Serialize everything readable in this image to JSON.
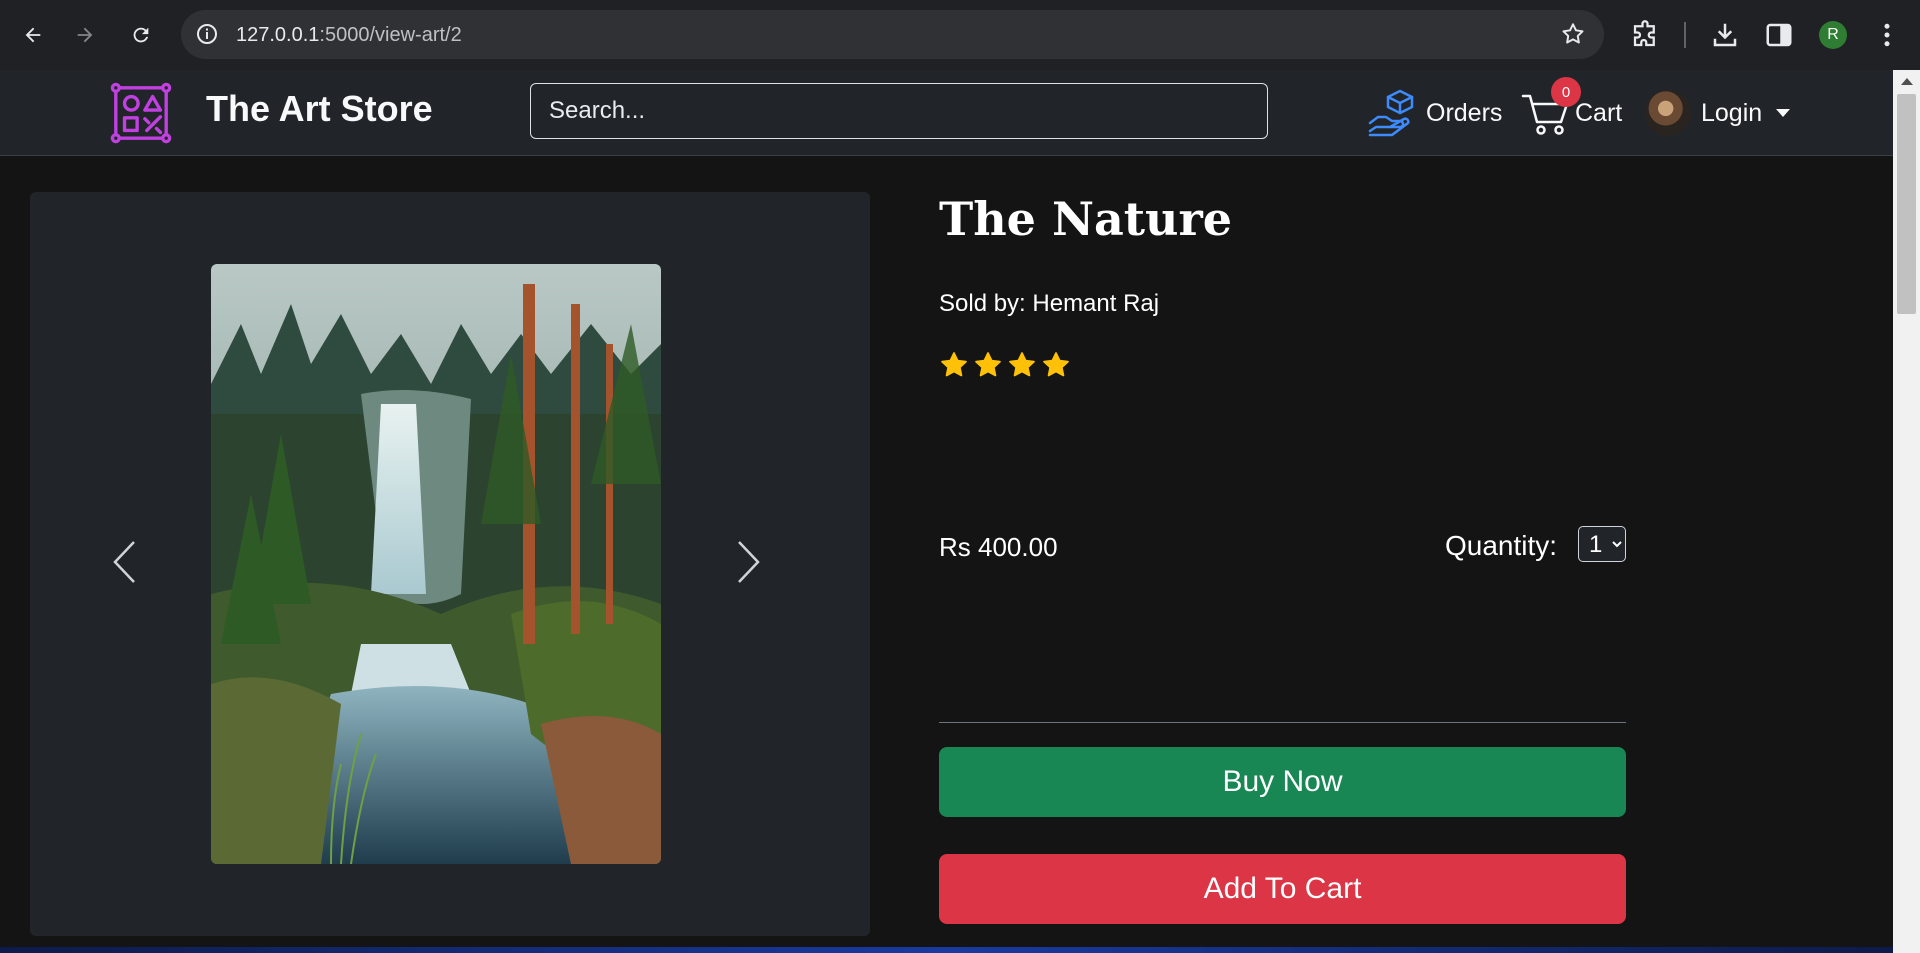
{
  "browser": {
    "url_host": "127.0.0.1",
    "url_path": ":5000/view-art/2",
    "profile_initial": "R"
  },
  "nav": {
    "brand": "The Art Store",
    "search_placeholder": "Search...",
    "orders_label": "Orders",
    "cart_label": "Cart",
    "cart_count": "0",
    "login_label": "Login"
  },
  "product": {
    "title": "The Nature",
    "seller": "Sold by: Hemant Raj",
    "rating": 4,
    "price": "Rs 400.00",
    "quantity_label": "Quantity:",
    "quantity_options": [
      "1"
    ],
    "quantity_value": "1",
    "buy_label": "Buy Now",
    "add_to_cart_label": "Add To Cart"
  },
  "colors": {
    "buy": "#198754",
    "cart": "#dc3545",
    "star": "#ffc107",
    "logo": "#c040e0"
  }
}
